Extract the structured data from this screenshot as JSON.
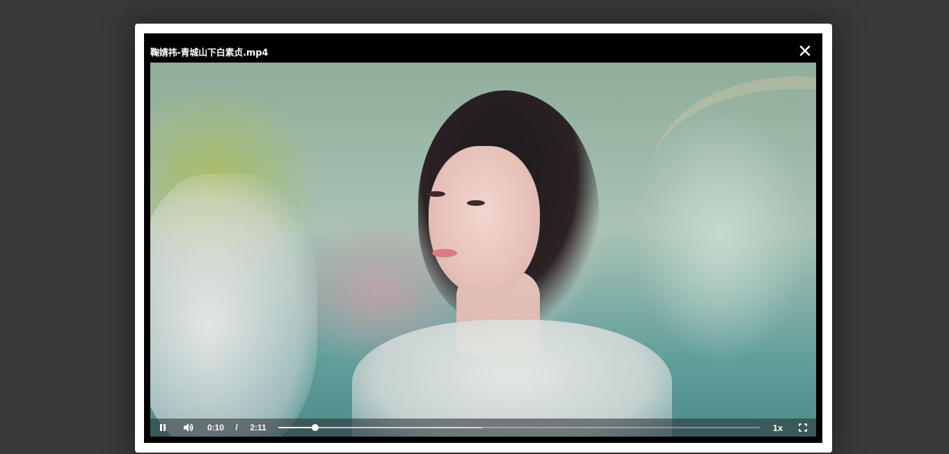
{
  "player": {
    "title": "鞠婧祎-青城山下白素贞.mp4",
    "close_icon": "close-icon"
  },
  "controls": {
    "play_state": "playing",
    "pause_icon": "pause-icon",
    "volume_icon": "volume-icon",
    "current_time": "0:10",
    "separator": "/",
    "total_time": "2:11",
    "progress_fraction": 0.076,
    "buffered_fraction": 0.424,
    "speed": "1x",
    "fullscreen_icon": "fullscreen-icon"
  },
  "colors": {
    "backdrop": "#3a3a3a",
    "frame": "#ffffff",
    "player_bg": "#000000",
    "control_text": "#ffffff"
  }
}
